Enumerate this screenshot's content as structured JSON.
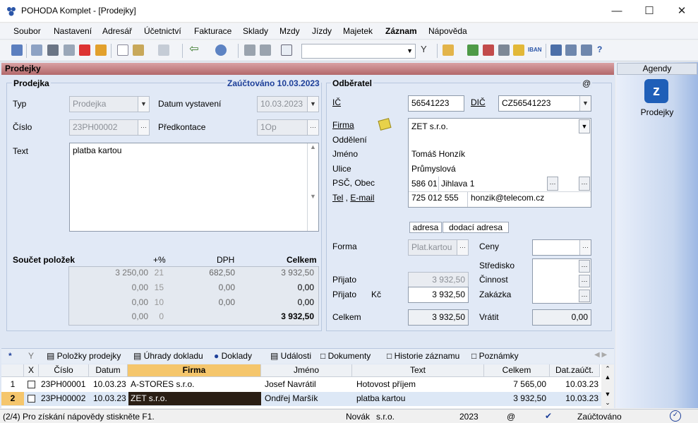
{
  "window": {
    "title": "POHODA Komplet - [Prodejky]"
  },
  "menu": [
    "Soubor",
    "Nastavení",
    "Adresář",
    "Účetnictví",
    "Fakturace",
    "Sklady",
    "Mzdy",
    "Jízdy",
    "Majetek",
    "Záznam",
    "Nápověda"
  ],
  "header": {
    "title": "Prodejky"
  },
  "left": {
    "section": "Prodejka",
    "accounted": "Zaúčtováno 10.03.2023",
    "type_label": "Typ",
    "type_value": "Prodejka",
    "date_label": "Datum vystavení",
    "date_value": "10.03.2023",
    "number_label": "Číslo",
    "number_value": "23PH00002",
    "precont_label": "Předkontace",
    "precont_value": "1Op",
    "text_label": "Text",
    "text_value": "platba kartou"
  },
  "sum": {
    "title": "Součet položek",
    "col_vat": "+%",
    "col_dph": "DPH",
    "col_total": "Celkem",
    "rows": [
      {
        "base": "3 250,00",
        "rate": "21",
        "dph": "682,50",
        "total": "3 932,50"
      },
      {
        "base": "0,00",
        "rate": "15",
        "dph": "0,00",
        "total": "0,00"
      },
      {
        "base": "0,00",
        "rate": "10",
        "dph": "0,00",
        "total": "0,00"
      },
      {
        "base": "0,00",
        "rate": "0",
        "dph": "",
        "total": "3 932,50"
      }
    ]
  },
  "partner": {
    "section": "Odběratel",
    "at": "@",
    "ic_label": "IČ",
    "ic_value": "56541223",
    "dic_label": "DIČ",
    "dic_value": "CZ56541223",
    "firm_label": "Firma",
    "firm_value": "ZET s.r.o.",
    "dept_label": "Oddělení",
    "name_label": "Jméno",
    "name_value": "Tomáš Honzík",
    "street_label": "Ulice",
    "street_value": "Průmyslová",
    "zip_label": "PSČ, Obec",
    "zip_value": "586 01",
    "city_value": "Jihlava 1",
    "tel_label": "Tel",
    "email_label": "E-mail",
    "tel_value": "725 012 555",
    "email_value": "honzik@telecom.cz",
    "tab_address": "adresa",
    "tab_delivery": "dodací adresa"
  },
  "pay": {
    "form_label": "Forma",
    "form_value": "Plat.kartou",
    "prices_label": "Ceny",
    "received_label": "Přijato",
    "received_value": "3 932,50",
    "received_kc_label": "Přijato",
    "kc": "Kč",
    "received_kc_value": "3 932,50",
    "total_label": "Celkem",
    "total_value": "3 932,50",
    "return_label": "Vrátit",
    "return_value": "0,00",
    "center_label": "Středisko",
    "activity_label": "Činnost",
    "order_label": "Zakázka"
  },
  "tabs": [
    "Položky prodejky",
    "Úhrady dokladu",
    "Doklady",
    "Události",
    "Dokumenty",
    "Historie záznamu",
    "Poznámky"
  ],
  "table": {
    "headers": [
      "X",
      "Číslo",
      "Datum",
      "Firma",
      "Jméno",
      "Text",
      "Celkem",
      "Dat.zaúčt."
    ],
    "rows": [
      {
        "n": "1",
        "cislo": "23PH00001",
        "datum": "10.03.23",
        "firma": "A-STORES s.r.o.",
        "jmeno": "Josef Navrátil",
        "text": "Hotovost příjem",
        "celkem": "7 565,00",
        "dat": "10.03.23"
      },
      {
        "n": "2",
        "cislo": "23PH00002",
        "datum": "10.03.23",
        "firma": "ZET s.r.o.",
        "jmeno": "Ondřej Maršík",
        "text": "platba kartou",
        "celkem": "3 932,50",
        "dat": "10.03.23"
      }
    ]
  },
  "status": {
    "help": "(2/4) Pro získání nápovědy stiskněte F1.",
    "user": "Novák",
    "company": "s.r.o.",
    "year": "2023",
    "at": "@",
    "state": "Zaúčtováno"
  },
  "sidebar": {
    "title": "Agendy",
    "item": "Prodejky"
  }
}
